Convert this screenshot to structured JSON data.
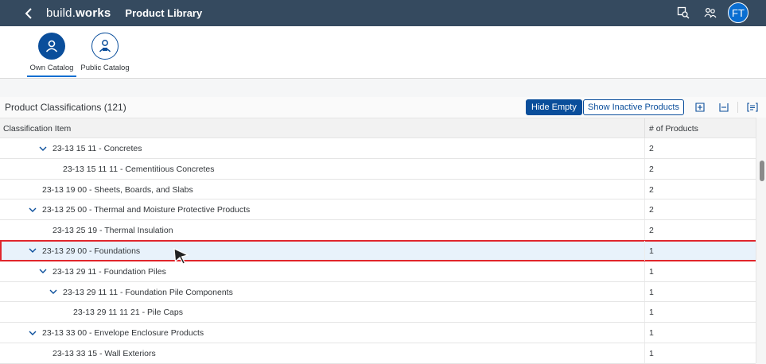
{
  "shell": {
    "brand_light": "build.",
    "brand_bold": "works",
    "title": "Product Library",
    "avatar_initials": "FT",
    "icons": [
      "chevron-left-icon",
      "product-search-icon",
      "user-group-icon"
    ]
  },
  "catalogs": [
    {
      "label": "Own Catalog",
      "icon": "user-icon",
      "active": true
    },
    {
      "label": "Public Catalog",
      "icon": "public-user-icon",
      "active": false
    }
  ],
  "table": {
    "title": "Product Classifications (121)",
    "hide_empty_label": "Hide Empty",
    "show_inactive_label": "Show Inactive Products",
    "toolbar_icons": [
      "expand-all-icon",
      "collapse-all-icon",
      "column-settings-icon"
    ],
    "columns": [
      "Classification Item",
      "# of Products"
    ],
    "rows": [
      {
        "name": "23-13 15 11 - Concretes",
        "count": "2",
        "expandable": true
      },
      {
        "name": "23-13 15 11 11 - Cementitious Concretes",
        "count": "2",
        "expandable": false
      },
      {
        "name": "23-13 19 00 - Sheets, Boards, and Slabs",
        "count": "2",
        "expandable": false
      },
      {
        "name": "23-13 25 00 - Thermal and Moisture Protective Products",
        "count": "2",
        "expandable": true
      },
      {
        "name": "23-13 25 19 - Thermal Insulation",
        "count": "2",
        "expandable": false
      },
      {
        "name": "23-13 29 00 - Foundations",
        "count": "1",
        "expandable": true,
        "selected": true
      },
      {
        "name": "23-13 29 11 - Foundation Piles",
        "count": "1",
        "expandable": true
      },
      {
        "name": "23-13 29 11 11 - Foundation Pile Components",
        "count": "1",
        "expandable": true
      },
      {
        "name": "23-13 29 11 11 21 - Pile Caps",
        "count": "1",
        "expandable": false
      },
      {
        "name": "23-13 33 00 - Envelope Enclosure Products",
        "count": "1",
        "expandable": true
      },
      {
        "name": "23-13 33 15 - Wall Exteriors",
        "count": "1",
        "expandable": false
      }
    ]
  },
  "colors": {
    "shell": "#354a5f",
    "accent": "#0a4e9b",
    "selection_border": "#e0262c"
  }
}
